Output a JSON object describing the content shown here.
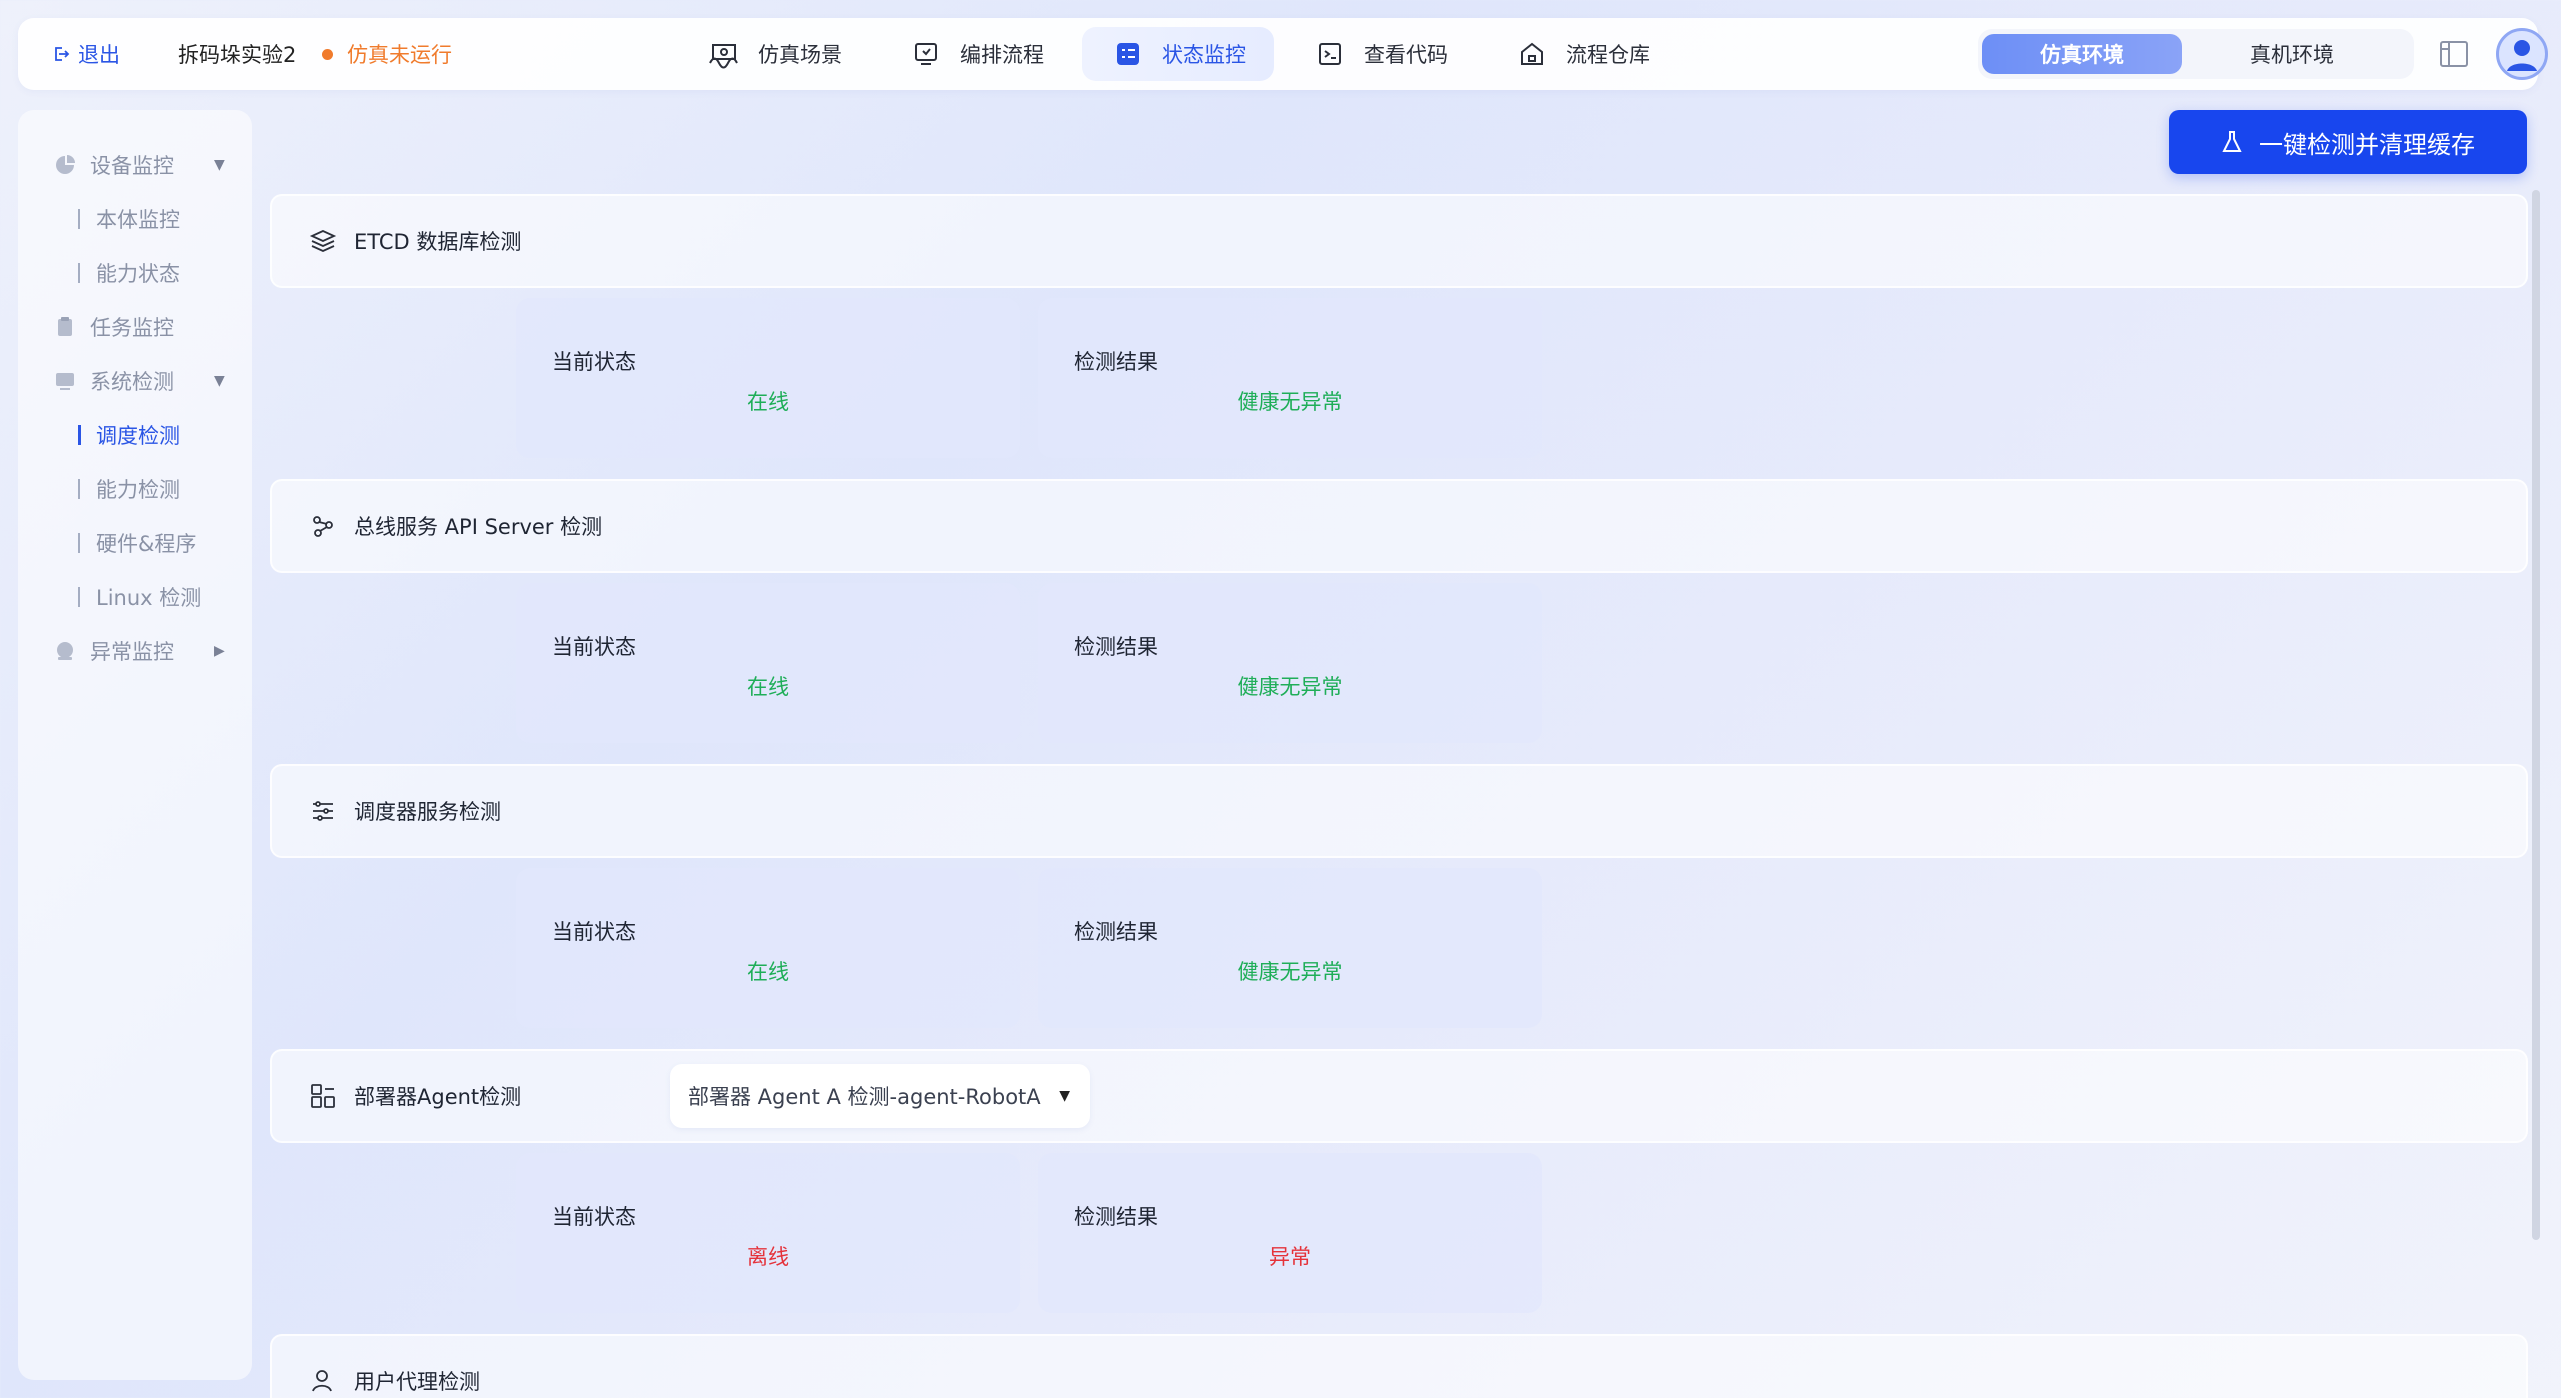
{
  "topbar": {
    "exit_label": "退出",
    "experiment_name": "拆码垛实验2",
    "sim_status": "仿真未运行",
    "nav": [
      {
        "label": "仿真场景",
        "icon": "simulation-scene-icon"
      },
      {
        "label": "编排流程",
        "icon": "workflow-icon"
      },
      {
        "label": "状态监控",
        "icon": "status-monitor-icon",
        "active": true
      },
      {
        "label": "查看代码",
        "icon": "code-icon"
      },
      {
        "label": "流程仓库",
        "icon": "repository-icon"
      }
    ],
    "env_options": [
      {
        "label": "仿真环境",
        "active": true
      },
      {
        "label": "真机环境",
        "active": false
      }
    ]
  },
  "sidebar": {
    "groups": [
      {
        "label": "设备监控",
        "icon": "pie-chart-icon",
        "expanded": true,
        "items": [
          {
            "label": "本体监控"
          },
          {
            "label": "能力状态"
          }
        ]
      },
      {
        "label": "任务监控",
        "icon": "clipboard-icon"
      },
      {
        "label": "系统检测",
        "icon": "monitor-icon",
        "expanded": true,
        "items": [
          {
            "label": "调度检测",
            "active": true
          },
          {
            "label": "能力检测"
          },
          {
            "label": "硬件&程序"
          },
          {
            "label": "Linux 检测"
          }
        ]
      },
      {
        "label": "异常监控",
        "icon": "alert-icon",
        "expanded": false
      }
    ]
  },
  "main": {
    "action_button": "一键检测并清理缓存",
    "status_label": "当前状态",
    "result_label": "检测结果",
    "sections": [
      {
        "title": "ETCD 数据库检测",
        "icon": "layers-icon",
        "status": "在线",
        "result": "健康无异常",
        "ok": true
      },
      {
        "title": "总线服务 API Server 检测",
        "icon": "share-nodes-icon",
        "status": "在线",
        "result": "健康无异常",
        "ok": true
      },
      {
        "title": "调度器服务检测",
        "icon": "sliders-icon",
        "status": "在线",
        "result": "健康无异常",
        "ok": true
      },
      {
        "title": "部署器Agent检测",
        "icon": "grid-icon",
        "status": "离线",
        "result": "异常",
        "ok": false,
        "select_value": "部署器 Agent A 检测-agent-RobotA"
      },
      {
        "title": "用户代理检测",
        "icon": "user-icon"
      }
    ]
  },
  "colors": {
    "accent": "#2a55e5",
    "primary_button": "#1846ee",
    "warning": "#f07b2c",
    "ok": "#1fae58",
    "error": "#e5323a"
  }
}
